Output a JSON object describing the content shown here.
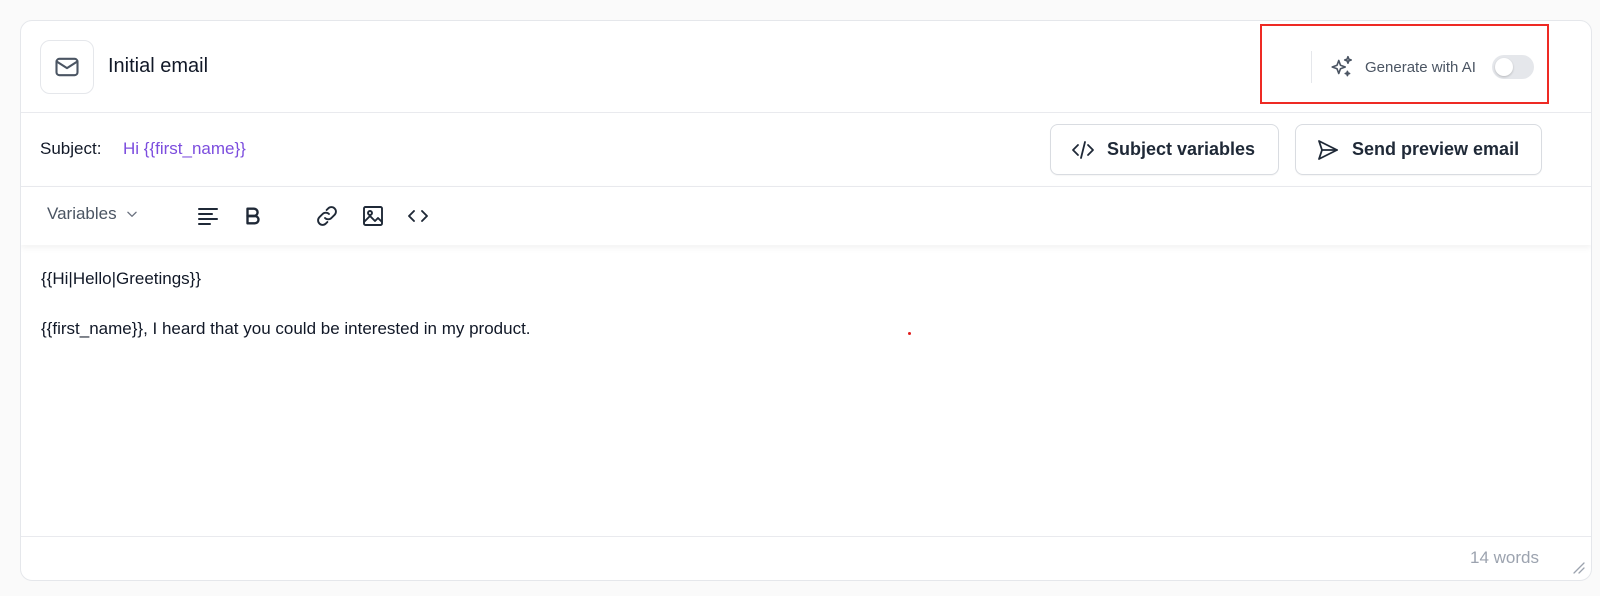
{
  "header": {
    "title": "Initial email",
    "icon": "mail-icon",
    "ai_label": "Generate with AI",
    "ai_icon": "sparkles-icon",
    "ai_enabled": false
  },
  "subject": {
    "label": "Subject:",
    "value": "Hi {{first_name}}",
    "value_color": "#7c4dde"
  },
  "buttons": {
    "subject_variables": "Subject variables",
    "send_preview": "Send preview email"
  },
  "toolbar": {
    "variables_label": "Variables",
    "tools": [
      "align-left-icon",
      "bold-icon",
      "link-icon",
      "image-icon",
      "code-icon"
    ]
  },
  "editor": {
    "line_1": "{{Hi|Hello|Greetings}}",
    "line_2": "{{first_name}}, I heard that you could be interested in my product."
  },
  "footer": {
    "word_count": "14 words"
  },
  "colors": {
    "highlight": "#ee2a24",
    "border": "#e5e7eb"
  }
}
